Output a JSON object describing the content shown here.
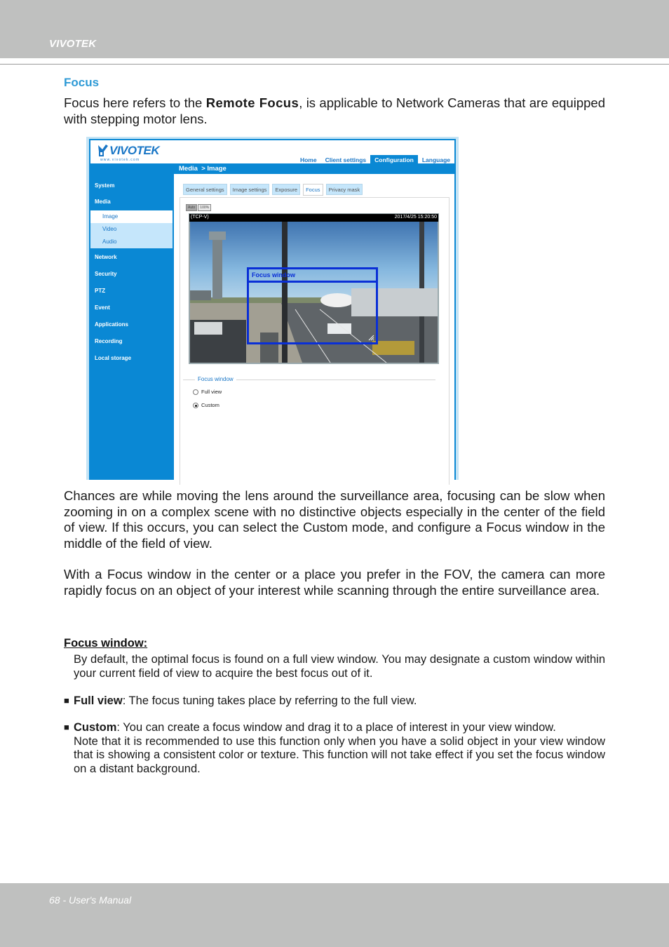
{
  "header": {
    "brand": "VIVOTEK"
  },
  "section": {
    "title": "Focus"
  },
  "intro": {
    "text_before": "Focus here refers to the ",
    "bold": "Remote Focus",
    "text_after": ", is applicable to Network Cameras that are equipped with stepping motor lens."
  },
  "screenshot": {
    "logo": {
      "word": "VIVOTEK",
      "url": "www.vivotek.com"
    },
    "topnav": [
      {
        "label": "Home",
        "active": false
      },
      {
        "label": "Client settings",
        "active": false
      },
      {
        "label": "Configuration",
        "active": true
      },
      {
        "label": "Language",
        "active": false
      }
    ],
    "breadcrumb": "Media  > Image",
    "sidebar": {
      "system": "System",
      "media": "Media",
      "media_sub": [
        "Image",
        "Video",
        "Audio"
      ],
      "items": [
        "Network",
        "Security",
        "PTZ",
        "Event",
        "Applications",
        "Recording",
        "Local storage"
      ]
    },
    "tabs": [
      {
        "label": "General settings",
        "active": false
      },
      {
        "label": "Image settings",
        "active": false
      },
      {
        "label": "Exposure",
        "active": false
      },
      {
        "label": "Focus",
        "active": true
      },
      {
        "label": "Privacy mask",
        "active": false
      }
    ],
    "view_buttons": {
      "auto": "Auto",
      "zoom": "100%"
    },
    "video": {
      "protocol": "(TCP-V)",
      "timestamp": "2017/4/25 15:20:50",
      "focus_window_label": "Focus window"
    },
    "focus_group": {
      "legend": "Focus window",
      "options": [
        {
          "label": "Full view",
          "checked": false
        },
        {
          "label": "Custom",
          "checked": true
        }
      ]
    },
    "colors": {
      "brand_blue": "#0a88d4",
      "focus_box": "#0a2fd6"
    }
  },
  "body": {
    "chances": "Chances are while moving the lens around the surveillance area, focusing can be slow when zooming in on a complex scene with no distinctive objects especially in the center of the field of view. If this occurs, you can select the Custom mode, and configure a Focus window in the middle of the field of view.",
    "with_focus": "With a Focus window in the center or a place you prefer in the FOV, the camera can more rapidly focus on an object of your interest while scanning through the entire surveillance area.",
    "subsection_title": "Focus window:",
    "default_text": "By default, the optimal focus is found on a full view window. You may designate a custom window within your current field of view to acquire the best focus out of it.",
    "full_view": {
      "bullet": "■",
      "label": "Full view",
      "text": ": The focus tuning takes place by referring to the full view."
    },
    "custom": {
      "bullet": "■",
      "label": "Custom",
      "text_first": ": You can create a focus window and drag it to a place of interest in your view window.",
      "text_rest": "Note that it is recommended to use this function only when you have a solid object in your view window that is showing a consistent color or texture. This function will not take effect if you set the focus window on a distant background."
    }
  },
  "footer": {
    "text": "68 - User's Manual"
  }
}
